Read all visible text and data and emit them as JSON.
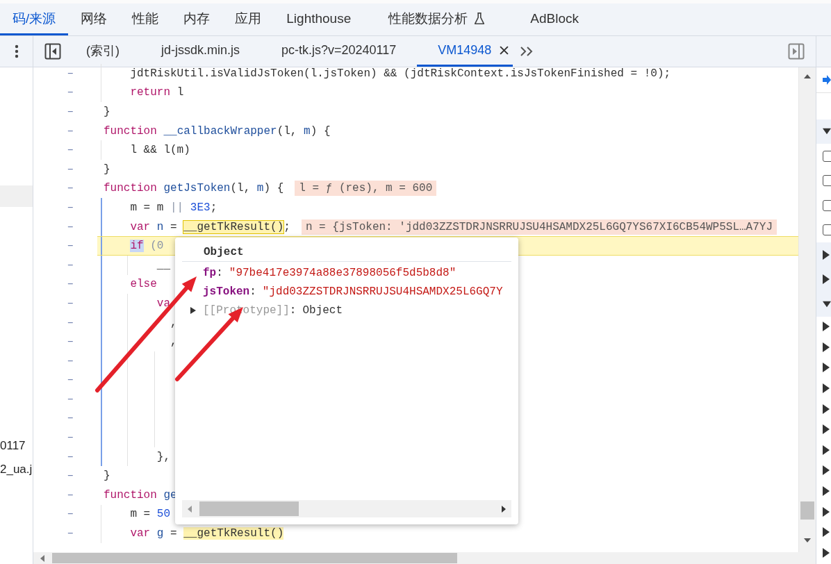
{
  "panel_tabs": [
    {
      "label": "码/来源",
      "selected": true
    },
    {
      "label": "网络",
      "selected": false
    },
    {
      "label": "性能",
      "selected": false
    },
    {
      "label": "内存",
      "selected": false
    },
    {
      "label": "应用",
      "selected": false
    },
    {
      "label": "Lighthouse",
      "selected": false
    },
    {
      "label": "性能数据分析",
      "selected": false,
      "experimental": true
    },
    {
      "label": "AdBlock",
      "selected": false
    }
  ],
  "file_tabs": [
    {
      "label": "(索引)",
      "selected": false
    },
    {
      "label": "jd-jssdk.min.js",
      "selected": false
    },
    {
      "label": "pc-tk.js?v=20240117",
      "selected": false
    },
    {
      "label": "VM14948",
      "selected": true
    }
  ],
  "navigator": {
    "items": [
      {
        "label": "0117"
      },
      {
        "label": "2_ua.j"
      }
    ]
  },
  "code_lines": [
    {
      "marker": "–",
      "tokens": [
        {
          "t": "    jdtRiskUtil.isValidJsToken(l.jsToken) && (jdtRiskContext.isJsTokenFinished = !0);",
          "kind": "plain"
        }
      ]
    },
    {
      "marker": "–",
      "tokens": [
        {
          "t": "    return",
          "kind": "kw"
        },
        {
          "t": " l",
          "kind": "plain"
        }
      ]
    },
    {
      "marker": "–",
      "tokens": [
        {
          "t": "}",
          "kind": "plain"
        }
      ]
    },
    {
      "marker": "–",
      "tokens": [
        {
          "t": "function",
          "kind": "kw"
        },
        {
          "t": " __callbackWrapper",
          "kind": "def"
        },
        {
          "t": "(l, ",
          "kind": "plain"
        },
        {
          "t": "m",
          "kind": "def"
        },
        {
          "t": ") {",
          "kind": "plain"
        }
      ]
    },
    {
      "marker": "–",
      "tokens": [
        {
          "t": "    l && l(m)",
          "kind": "plain"
        }
      ]
    },
    {
      "marker": "–",
      "tokens": [
        {
          "t": "}",
          "kind": "plain"
        }
      ]
    },
    {
      "marker": "–",
      "tokens": [
        {
          "t": "function",
          "kind": "kw"
        },
        {
          "t": " getJsToken",
          "kind": "def"
        },
        {
          "t": "(l, ",
          "kind": "plain"
        },
        {
          "t": "m",
          "kind": "def"
        },
        {
          "t": ") {",
          "kind": "plain"
        }
      ],
      "inline_value": "l = ƒ (res), m = 600"
    },
    {
      "marker": "–",
      "scope": true,
      "tokens": [
        {
          "t": "    m = m ",
          "kind": "plain"
        },
        {
          "t": "||",
          "kind": "op"
        },
        {
          "t": " 3E3",
          "kind": "num"
        },
        {
          "t": ";",
          "kind": "plain"
        }
      ]
    },
    {
      "marker": "–",
      "scope": true,
      "tokens": [
        {
          "t": "    var",
          "kind": "kw"
        },
        {
          "t": " n",
          "kind": "def"
        },
        {
          "t": " = ",
          "kind": "plain"
        },
        {
          "t": "__getTkResult()",
          "kind": "boxed"
        },
        {
          "t": ";",
          "kind": "plain"
        }
      ],
      "inline_value": "n = {jsToken: 'jdd03ZZSTDRJNSRRUJSU4HSAMDX25L6GQ7YS67XI6CB54WP5SL…A7YJ"
    },
    {
      "marker": "–",
      "scope": true,
      "paused": true,
      "tokens": [
        {
          "t": "    if",
          "kind": "kwsel"
        },
        {
          "t": " (0",
          "kind": "op"
        }
      ]
    },
    {
      "marker": "–",
      "scope": true,
      "tokens": [
        {
          "t": "        __",
          "kind": "plain"
        }
      ]
    },
    {
      "marker": "–",
      "scope": true,
      "tokens": [
        {
          "t": "    else",
          "kind": "kw"
        }
      ]
    },
    {
      "marker": "–",
      "scope": true,
      "tokens": [
        {
          "t": "        va",
          "kind": "kw"
        }
      ]
    },
    {
      "marker": "–",
      "scope": true,
      "tokens": [
        {
          "t": "          ,",
          "kind": "plain"
        }
      ]
    },
    {
      "marker": "–",
      "scope": true,
      "tokens": [
        {
          "t": "          ,",
          "kind": "plain"
        }
      ]
    },
    {
      "marker": "–",
      "scope": true
    },
    {
      "marker": "–",
      "scope": true
    },
    {
      "marker": "–",
      "scope": true
    },
    {
      "marker": "–",
      "scope": true
    },
    {
      "marker": "–",
      "scope": true
    },
    {
      "marker": "–",
      "scope": true,
      "tokens": [
        {
          "t": "        },",
          "kind": "plain"
        }
      ]
    },
    {
      "marker": "–",
      "tokens": [
        {
          "t": "}",
          "kind": "plain"
        }
      ]
    },
    {
      "marker": "–",
      "tokens": [
        {
          "t": "function",
          "kind": "kw"
        },
        {
          "t": " ge",
          "kind": "def"
        }
      ]
    },
    {
      "marker": "–",
      "tokens": [
        {
          "t": "    m = ",
          "kind": "plain"
        },
        {
          "t": "50",
          "kind": "num"
        }
      ]
    },
    {
      "marker": "–",
      "tokens": [
        {
          "t": "    var",
          "kind": "kw"
        },
        {
          "t": " g",
          "kind": "def"
        },
        {
          "t": " = ",
          "kind": "plain"
        },
        {
          "t": "__getTkResult()",
          "kind": "hl"
        }
      ]
    }
  ],
  "popover": {
    "title": "Object",
    "properties": [
      {
        "key": "fp",
        "separator": ":",
        "value": "\"97be417e3974a88e37898056f5d5b8d8\"",
        "kind": "own"
      },
      {
        "key": "jsToken",
        "separator": ":",
        "value": "\"jdd03ZZSTDRJNSRRUJSU4HSAMDX25L6GQ7Y",
        "kind": "own"
      },
      {
        "key": "[[Prototype]]",
        "separator": ":",
        "value": "Object",
        "kind": "internal",
        "expanded": false
      }
    ]
  },
  "annotations": [
    {
      "kind": "arrow"
    },
    {
      "kind": "arrow"
    }
  ],
  "right_panel": {
    "rows": [
      {
        "kind": "toolbar"
      },
      {
        "kind": "blank"
      },
      {
        "kind": "section",
        "expanded": true
      },
      {
        "kind": "checkbox",
        "checked": false
      },
      {
        "kind": "checkbox",
        "checked": false
      },
      {
        "kind": "checkbox",
        "checked": false
      },
      {
        "kind": "checkbox",
        "checked": false
      },
      {
        "kind": "section",
        "expanded": false
      },
      {
        "kind": "section",
        "expanded": false
      },
      {
        "kind": "section",
        "expanded": true
      },
      {
        "kind": "item",
        "expanded": false
      },
      {
        "kind": "item",
        "expanded": false
      },
      {
        "kind": "item",
        "expanded": false
      },
      {
        "kind": "item",
        "expanded": false
      },
      {
        "kind": "item",
        "expanded": false
      },
      {
        "kind": "item",
        "expanded": false
      },
      {
        "kind": "item",
        "expanded": false
      },
      {
        "kind": "item",
        "expanded": false
      },
      {
        "kind": "item",
        "expanded": false
      },
      {
        "kind": "item",
        "expanded": false
      },
      {
        "kind": "item",
        "expanded": false
      },
      {
        "kind": "item",
        "expanded": false
      }
    ]
  }
}
